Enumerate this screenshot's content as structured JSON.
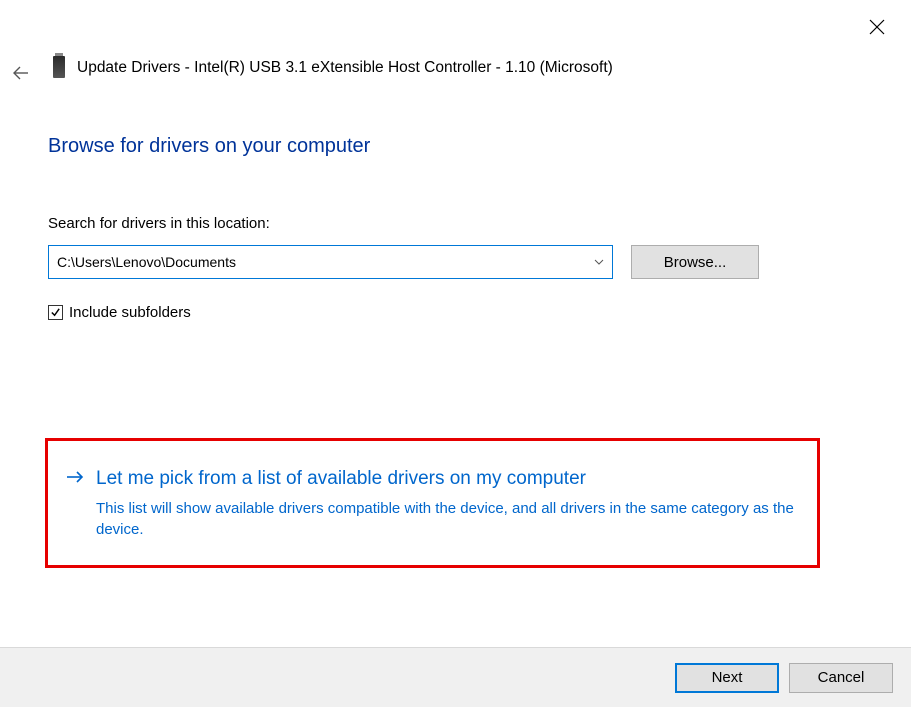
{
  "window": {
    "title": "Update Drivers - Intel(R) USB 3.1 eXtensible Host Controller - 1.10 (Microsoft)"
  },
  "heading": "Browse for drivers on your computer",
  "search": {
    "label": "Search for drivers in this location:",
    "path": "C:\\Users\\Lenovo\\Documents",
    "browse_label": "Browse...",
    "include_subfolders_label": "Include subfolders",
    "include_subfolders_checked": true
  },
  "pick_option": {
    "title": "Let me pick from a list of available drivers on my computer",
    "description": "This list will show available drivers compatible with the device, and all drivers in the same category as the device."
  },
  "footer": {
    "next_label": "Next",
    "cancel_label": "Cancel"
  },
  "annotation": {
    "highlight_color": "#e60000"
  }
}
